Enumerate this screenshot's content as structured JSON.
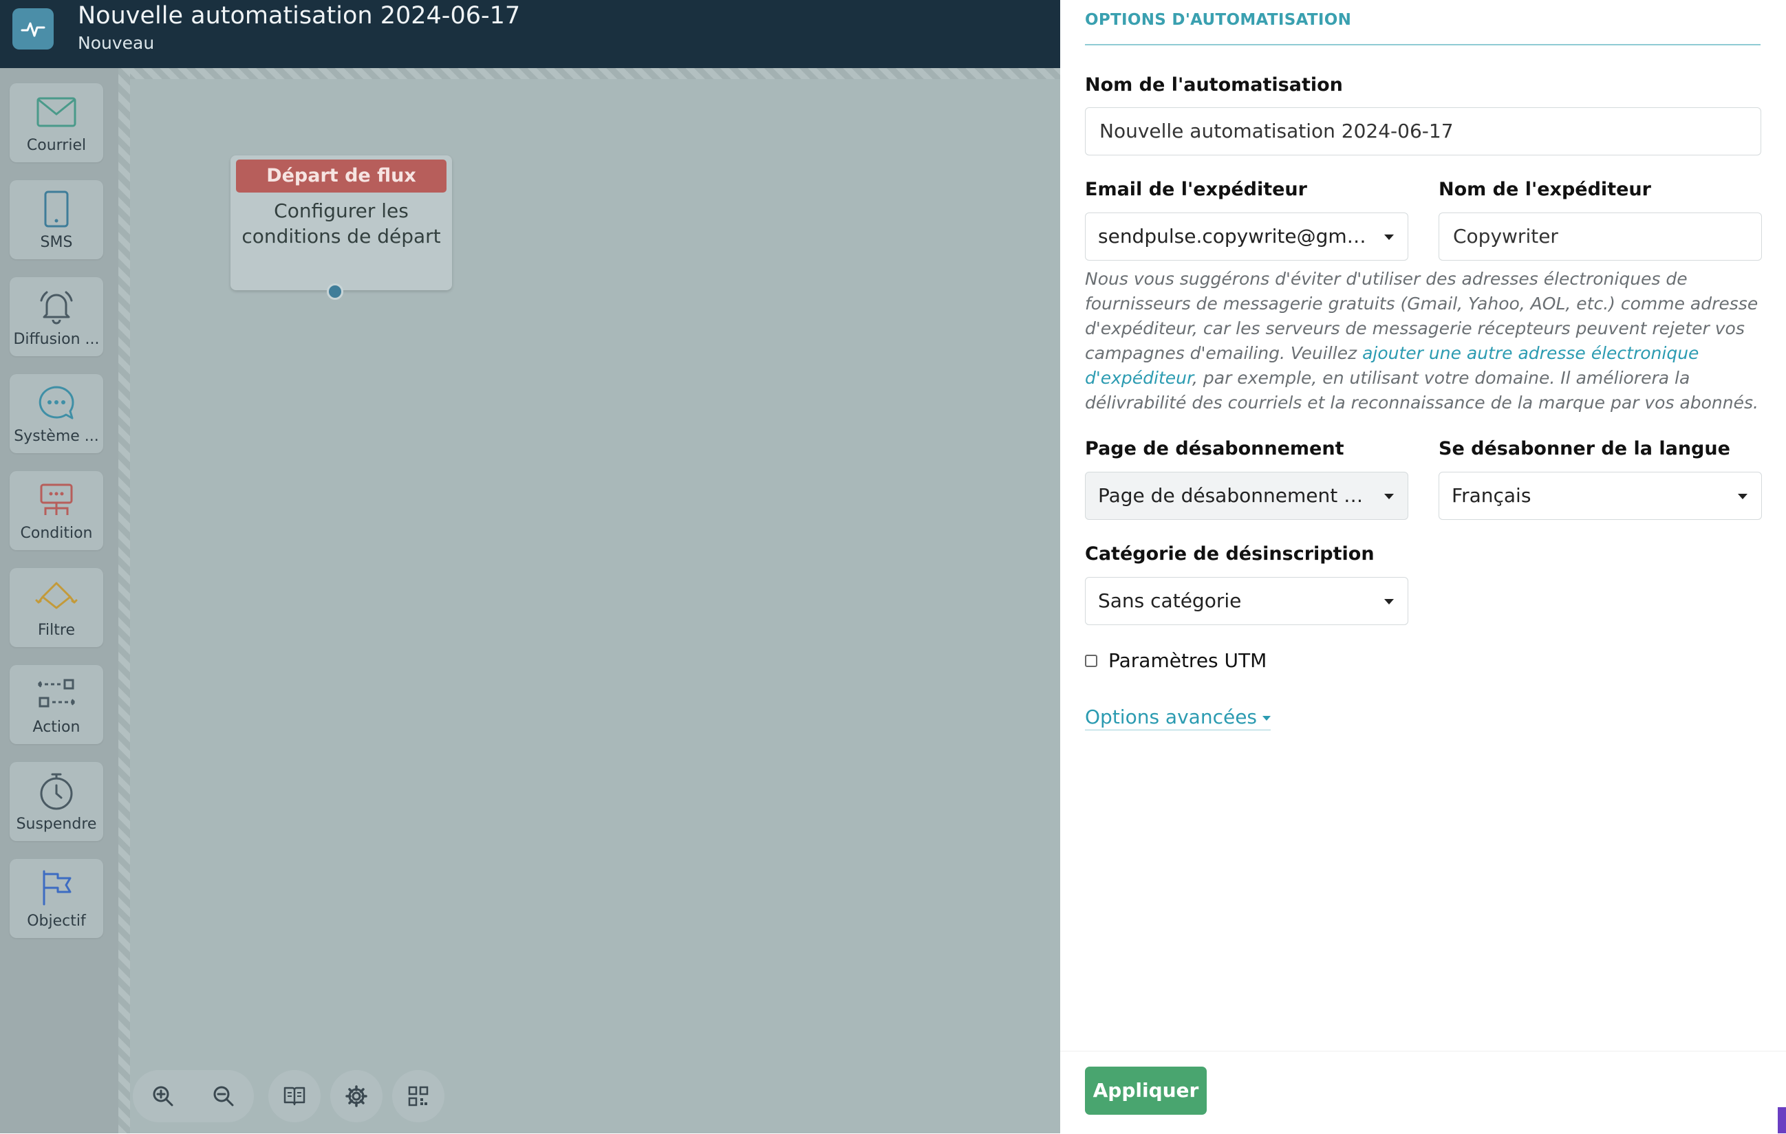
{
  "header": {
    "title": "Nouvelle automatisation 2024-06-17",
    "subtitle": "Nouveau"
  },
  "palette": [
    {
      "label": "Courriel",
      "icon": "envelope-icon"
    },
    {
      "label": "SMS",
      "icon": "phone-icon"
    },
    {
      "label": "Diffusion ...",
      "icon": "bell-icon"
    },
    {
      "label": "Système ...",
      "icon": "chat-bubble-icon"
    },
    {
      "label": "Condition",
      "icon": "condition-icon"
    },
    {
      "label": "Filtre",
      "icon": "filter-icon"
    },
    {
      "label": "Action",
      "icon": "action-icon"
    },
    {
      "label": "Suspendre",
      "icon": "timer-icon"
    },
    {
      "label": "Objectif",
      "icon": "flag-icon"
    }
  ],
  "canvas": {
    "start_node": {
      "title": "Départ de flux",
      "body": "Configurer les conditions de départ"
    },
    "toolbar": [
      "zoom-in-icon",
      "zoom-out-icon",
      "book-icon",
      "gear-icon",
      "qr-icon"
    ]
  },
  "panel": {
    "title": "OPTIONS D'AUTOMATISATION",
    "name_label": "Nom de l'automatisation",
    "name_value": "Nouvelle automatisation 2024-06-17",
    "sender_email_label": "Email de l'expéditeur",
    "sender_email_value": "sendpulse.copywrite@gmail...",
    "sender_name_label": "Nom de l'expéditeur",
    "sender_name_value": "Copywriter",
    "hint_before": "Nous vous suggérons d'éviter d'utiliser des adresses électroniques de fournisseurs de messagerie gratuits (Gmail, Yahoo, AOL, etc.) comme adresse d'expéditeur, car les serveurs de messagerie récepteurs peuvent rejeter vos campagnes d'emailing. Veuillez ",
    "hint_link": "ajouter une autre adresse électronique d'expéditeur",
    "hint_after": ", par exemple, en utilisant votre domaine. Il améliorera la délivrabilité des courriels et la reconnaissance de la marque par vos abonnés.",
    "unsub_page_label": "Page de désabonnement",
    "unsub_page_value": "Page de désabonnement pa...",
    "unsub_lang_label": "Se désabonner de la langue",
    "unsub_lang_value": "Français",
    "unsub_category_label": "Catégorie de désinscription",
    "unsub_category_value": "Sans catégorie",
    "utm_label": "Paramètres UTM",
    "utm_checked": false,
    "advanced_label": "Options avancées",
    "apply_label": "Appliquer"
  },
  "colors": {
    "header_bg": "#1a303f",
    "canvas_bg": "#a9b8b9",
    "start_node_head": "#b75e5b",
    "accent": "#3aa0b0",
    "apply_button": "#49a56f"
  }
}
